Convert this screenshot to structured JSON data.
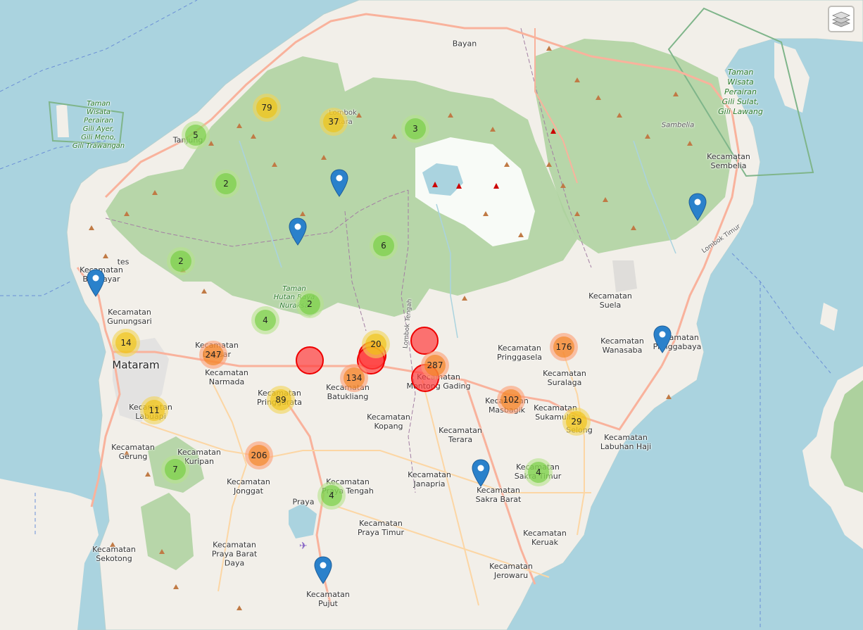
{
  "map": {
    "colors": {
      "sea": "#aad3df",
      "land": "#f2efe9",
      "forest": "#add19e",
      "volcano": "#ffffff",
      "primary_road": "#f9b29c",
      "secondary_road": "#fcd6a4",
      "boundary": "#a37fa3"
    },
    "labels": {
      "mataram": "Mataram",
      "bayan": "Bayan",
      "tanjung": "Tanjung",
      "praya": "Praya",
      "lombok_utara": "Lombok\nUtara",
      "lombok_timur": "Lombok Timur",
      "lombok_tengah": "Lombok Tengah",
      "sambelia": "Sambelia",
      "park_gili": "Taman\nWisata\nPerairan\nGili Ayer,\nGili Meno,\nGili Trawangan",
      "park_sulat": "Taman\nWisata\nPerairan\nGili Sulat,\nGili Lawang",
      "park_nuraksa": "Taman\nHutan Raya\nNuraksa",
      "kec_sembelia": "Kecamatan\nSembelia",
      "kec_suela": "Kecamatan\nSuela",
      "kec_wanasaba": "Kecamatan\nWanasaba",
      "kec_pringgabaya": "Kecamatan\nPringgabaya",
      "kec_pringgasela": "Kecamatan\nPringgasela",
      "kec_suralaga": "Kecamatan\nSuralaga",
      "kec_masbagik": "Kecamatan\nMasbagik",
      "kec_sukamulia": "Kecamatan\nSukamulia",
      "selong": "Selong",
      "kec_labuhan_haji": "Kecamatan\nLabuhan Haji",
      "kec_sakra_timur": "Kecamatan\nSakra Timur",
      "kec_sakra_barat": "Kecamatan\nSakra Barat",
      "kec_keruak": "Kecamatan\nKeruak",
      "kec_jerowaru": "Kecamatan\nJerowaru",
      "kec_praya_timur": "Kecamatan\nPraya Timur",
      "kec_janapria": "Kecamatan\nJanapria",
      "kec_terara": "Kecamatan\nTerara",
      "kec_montong_gading": "Kecamatan\nMontong Gading",
      "kec_kopang": "Kecamatan\nKopang",
      "kec_batukliang": "Kecamatan\nBatukliang",
      "kec_praya_tengah": "Kecamatan\nPraya Tengah",
      "kec_pujut": "Kecamatan\nPujut",
      "kec_praya_barat_daya": "Kecamatan\nPraya Barat\nDaya",
      "kec_jonggat": "Kecamatan\nJonggat",
      "kec_pringgarata": "Kecamatan\nPringgarata",
      "kec_narmada": "Kecamatan\nNarmada",
      "kec_lingsar": "Kecamatan\nLingsar",
      "kec_gunungsari": "Kecamatan\nGunungsari",
      "kec_batulayar": "Kecamatan\nBatulayar",
      "kec_labuapi": "Kecamatan\nLabuapi",
      "kec_gerung": "Kecamatan\nGerung",
      "kec_kuripan": "Kecamatan\nKuripan",
      "kec_sekotong": "Kecamatan\nSekotong",
      "tes": "tes"
    },
    "clusters": [
      {
        "count": "79",
        "size": "medium"
      },
      {
        "count": "37",
        "size": "medium"
      },
      {
        "count": "3",
        "size": "small"
      },
      {
        "count": "5",
        "size": "small"
      },
      {
        "count": "2",
        "size": "small"
      },
      {
        "count": "6",
        "size": "small"
      },
      {
        "count": "2",
        "size": "small"
      },
      {
        "count": "2",
        "size": "small"
      },
      {
        "count": "4",
        "size": "small"
      },
      {
        "count": "14",
        "size": "medium"
      },
      {
        "count": "247",
        "size": "large"
      },
      {
        "count": "20",
        "size": "medium"
      },
      {
        "count": "134",
        "size": "large"
      },
      {
        "count": "287",
        "size": "large"
      },
      {
        "count": "176",
        "size": "large"
      },
      {
        "count": "89",
        "size": "medium"
      },
      {
        "count": "11",
        "size": "medium"
      },
      {
        "count": "102",
        "size": "large"
      },
      {
        "count": "29",
        "size": "medium"
      },
      {
        "count": "206",
        "size": "large"
      },
      {
        "count": "7",
        "size": "small"
      },
      {
        "count": "4",
        "size": "small"
      },
      {
        "count": "4",
        "size": "small"
      }
    ],
    "marker_color": "#2a81cb",
    "layer_control": "layers-icon"
  }
}
